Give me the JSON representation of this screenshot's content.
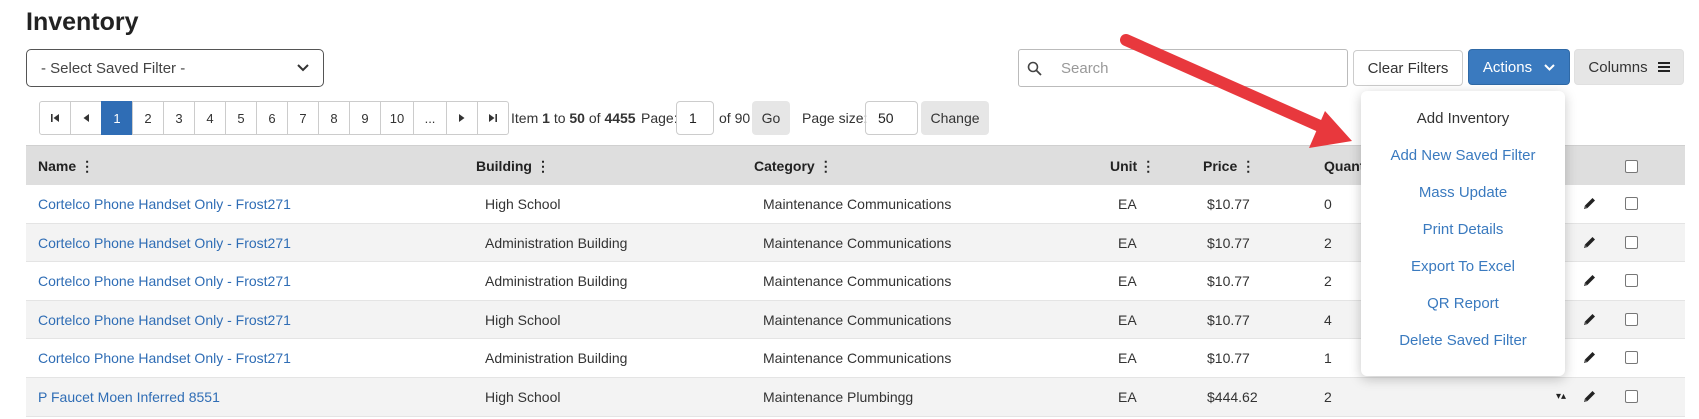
{
  "page": {
    "title": "Inventory"
  },
  "filter_select": {
    "value": "- Select Saved Filter -"
  },
  "search": {
    "placeholder": "Search",
    "value": ""
  },
  "toolbar": {
    "clear_filters": "Clear Filters",
    "actions": "Actions",
    "columns": "Columns"
  },
  "pager": {
    "pages": [
      "1",
      "2",
      "3",
      "4",
      "5",
      "6",
      "7",
      "8",
      "9",
      "10",
      "..."
    ],
    "active_page": "1",
    "item_prefix": "Item",
    "item_from": "1",
    "item_to_word": "to",
    "item_to": "50",
    "item_of_word": "of",
    "item_total": "4455",
    "page_label": "Page:",
    "page_value": "1",
    "of_pages": "of 90",
    "go": "Go",
    "size_label": "Page size:",
    "size_value": "50",
    "change": "Change"
  },
  "table": {
    "headers": {
      "name": "Name",
      "building": "Building",
      "category": "Category",
      "unit": "Unit",
      "price": "Price",
      "quantity": "Quant"
    },
    "rows": [
      {
        "name": "Cortelco Phone Handset Only - Frost271",
        "building": "High School",
        "category": "Maintenance Communications",
        "unit": "EA",
        "price": "$10.77",
        "quantity": "0"
      },
      {
        "name": "Cortelco Phone Handset Only - Frost271",
        "building": "Administration Building",
        "category": "Maintenance Communications",
        "unit": "EA",
        "price": "$10.77",
        "quantity": "2"
      },
      {
        "name": "Cortelco Phone Handset Only - Frost271",
        "building": "Administration Building",
        "category": "Maintenance Communications",
        "unit": "EA",
        "price": "$10.77",
        "quantity": "2"
      },
      {
        "name": "Cortelco Phone Handset Only - Frost271",
        "building": "High School",
        "category": "Maintenance Communications",
        "unit": "EA",
        "price": "$10.77",
        "quantity": "4"
      },
      {
        "name": "Cortelco Phone Handset Only - Frost271",
        "building": "Administration Building",
        "category": "Maintenance Communications",
        "unit": "EA",
        "price": "$10.77",
        "quantity": "1"
      },
      {
        "name": "P Faucet Moen Inferred 8551",
        "building": "High School",
        "category": "Maintenance Plumbingg",
        "unit": "EA",
        "price": "$444.62",
        "quantity": "2"
      }
    ]
  },
  "actions_menu": {
    "items": [
      "Add Inventory",
      "Add New Saved Filter",
      "Mass Update",
      "Print Details",
      "Export To Excel",
      "QR Report",
      "Delete Saved Filter"
    ]
  },
  "colors": {
    "primary": "#3a7abf",
    "link": "#2f6db5",
    "annotation_arrow": "#e8383d",
    "header_bg": "#dedede"
  }
}
